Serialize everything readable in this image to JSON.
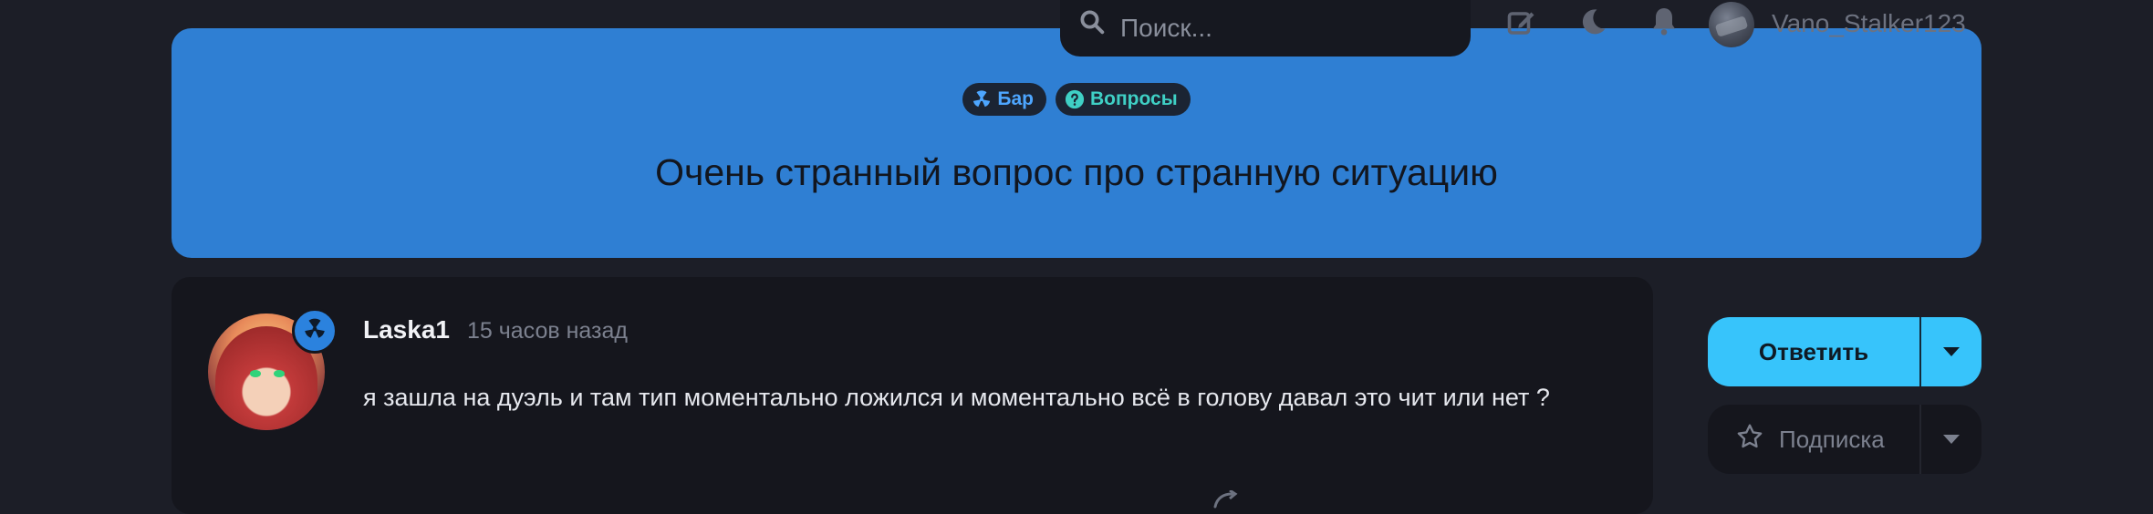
{
  "nav": {
    "search_placeholder": "Поиск...",
    "username": "Vano_Stalker123"
  },
  "topic": {
    "tags": [
      {
        "label": "Бар",
        "icon": "radiation-icon",
        "color": "#4da6ff"
      },
      {
        "label": "Вопросы",
        "icon": "question-circle-icon",
        "color": "#3fd0c5"
      }
    ],
    "title": "Очень странный вопрос про странную ситуацию"
  },
  "post": {
    "author": "Laska1",
    "time": "15 часов назад",
    "text": "я зашла на дуэль и там тип моментально ложился и моментально всё в голову давал это чит или нет ?"
  },
  "actions": {
    "reply_label": "Ответить",
    "subscribe_label": "Подписка"
  },
  "colors": {
    "background": "#1c1e27",
    "hero": "#2f7fd3",
    "accent": "#37c4fb",
    "card": "#15161d"
  }
}
